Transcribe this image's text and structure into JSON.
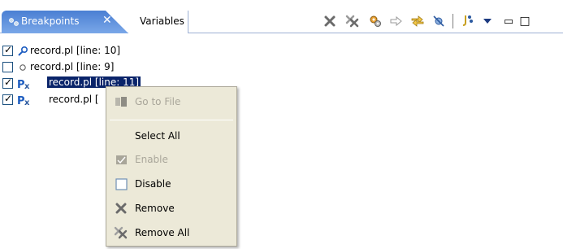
{
  "tabs": {
    "active_label": "Breakpoints",
    "active_close": "✕",
    "inactive_label": "Variables"
  },
  "toolbar": {
    "icons": [
      "remove-breakpoint-icon",
      "remove-all-breakpoints-icon",
      "link-with-debug-view-icon",
      "go-to-file-icon",
      "expand-icon",
      "skip-all-breakpoints-icon",
      "add-watchpoint-icon",
      "view-menu-icon",
      "minimize-icon",
      "maximize-icon"
    ],
    "minimize_label": "▭",
    "maximize_label": "□"
  },
  "breakpoints": [
    {
      "label": "record.pl [line: 10]",
      "checked": true,
      "icon": "line-breakpoint-icon"
    },
    {
      "label": "record.pl [line: 9]",
      "checked": false,
      "icon": "disabled-breakpoint-icon"
    },
    {
      "label": "record.pl [line: 11]",
      "checked": true,
      "icon": "enabled-breakpoint-icon",
      "selected": true
    },
    {
      "label": "record.pl [",
      "checked": true,
      "icon": "enabled-breakpoint-icon"
    }
  ],
  "context_menu": {
    "items": [
      {
        "label": "Go to File",
        "enabled": false,
        "icon": "go-to-file-icon"
      },
      {
        "label": "Select All",
        "enabled": true,
        "icon": ""
      },
      {
        "label": "Enable",
        "enabled": false,
        "icon": "enable-icon"
      },
      {
        "label": "Disable",
        "enabled": true,
        "icon": "disable-icon"
      },
      {
        "label": "Remove",
        "enabled": true,
        "icon": "remove-icon"
      },
      {
        "label": "Remove All",
        "enabled": true,
        "icon": "remove-all-icon"
      }
    ]
  },
  "colors": {
    "tab_active": "#4a7fd3",
    "selection": "#0a246a",
    "menu_bg": "#ece9d8"
  }
}
